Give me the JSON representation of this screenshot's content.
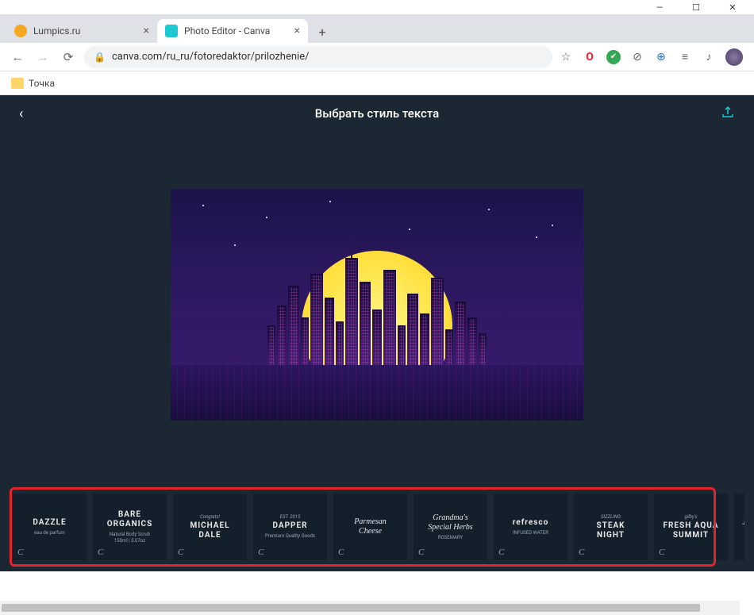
{
  "window": {
    "minimize": "—",
    "maximize": "☐",
    "close": "✕"
  },
  "tabs": [
    {
      "title": "Lumpics.ru",
      "favicon": "#f5a623",
      "active": false
    },
    {
      "title": "Photo Editor - Canva",
      "favicon": "#1bc8d4",
      "active": true
    }
  ],
  "newtab": "+",
  "nav": {
    "back": "←",
    "forward": "→",
    "reload": "⟳"
  },
  "url": "canva.com/ru_ru/fotoredaktor/prilozhenie/",
  "ext": {
    "star": "☆",
    "opera": "O",
    "check": "✔",
    "block": "⊘",
    "globe": "⊕",
    "list": "≡",
    "listcheck": "♪",
    "avatar": "#6b5b8a"
  },
  "bookmarks": [
    {
      "label": "Точка"
    }
  ],
  "app": {
    "back": "‹",
    "title": "Выбрать стиль текста",
    "share": "⤴"
  },
  "templates": [
    {
      "pre": "",
      "main": "DAZZLE",
      "sub": "eau de parfum"
    },
    {
      "pre": "",
      "main": "BARE\nORGANICS",
      "sub": "Natural Body Scrub\n150ml | 5.07oz"
    },
    {
      "pre": "Congrats!",
      "main": "MICHAEL\nDALE",
      "sub": ""
    },
    {
      "pre": "EST. 2015",
      "main": "DAPPER",
      "sub": "Premium Quality Goods"
    },
    {
      "pre": "",
      "main": "Parmesan\nCheese",
      "sub": ""
    },
    {
      "pre": "",
      "main": "Grandma's\nSpecial Herbs",
      "sub": "ROSEMARY"
    },
    {
      "pre": "",
      "main": "refresco",
      "sub": "INFUSED WATER"
    },
    {
      "pre": "SIZZLING",
      "main": "STEAK\nNIGHT",
      "sub": ""
    },
    {
      "pre": "gilby's",
      "main": "FRESH AQUA\nSUMMIT",
      "sub": ""
    },
    {
      "pre": "",
      "main": "Ja",
      "sub": "&"
    }
  ],
  "tpl_badge": "C"
}
